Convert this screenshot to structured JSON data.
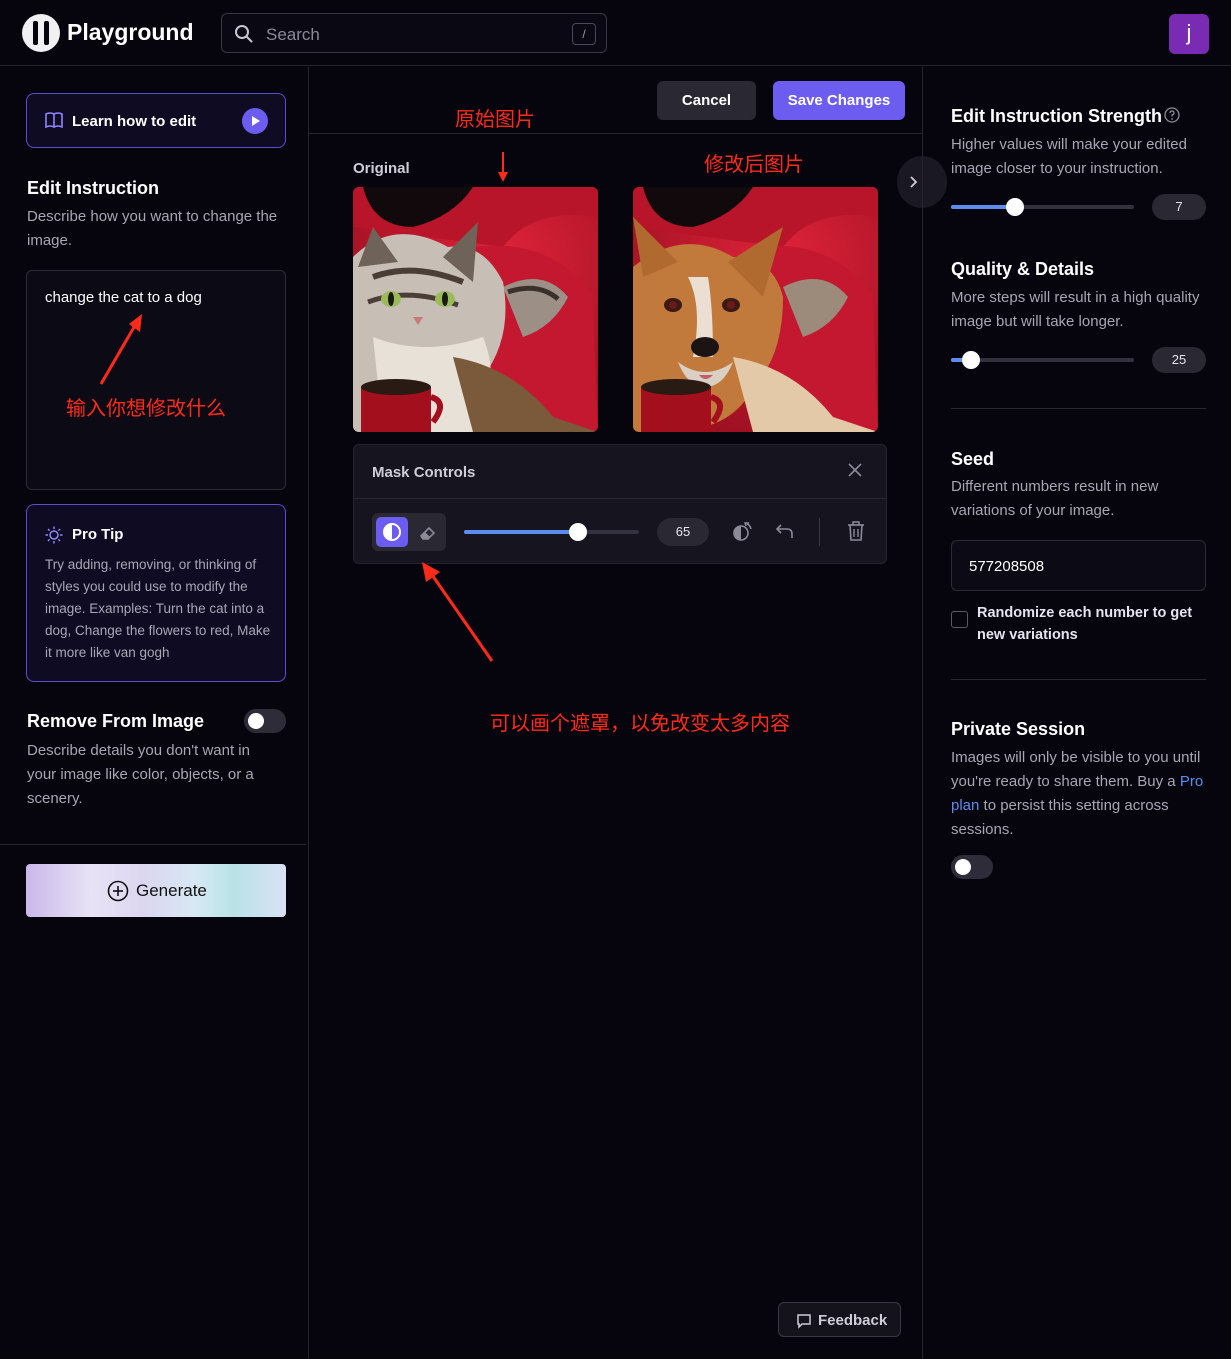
{
  "header": {
    "brand": "Playground",
    "search_placeholder": "Search",
    "search_shortcut": "/",
    "avatar_letter": "j"
  },
  "left": {
    "learn_label": "Learn how to edit",
    "edit_title": "Edit Instruction",
    "edit_desc": "Describe how you want to change the image.",
    "edit_value": "change the cat to a dog",
    "protip_title": "Pro Tip",
    "protip_body": "Try adding, removing, or thinking of styles you could use to modify the image. Examples: Turn the cat into a dog, Change the flowers to red, Make it more like van gogh",
    "remove_title": "Remove From Image",
    "remove_enabled": false,
    "remove_desc": "Describe details you don't want in your image like color, objects, or a scenery.",
    "generate_label": "Generate"
  },
  "center": {
    "cancel_label": "Cancel",
    "save_label": "Save Changes",
    "original_label": "Original",
    "mask_title": "Mask Controls",
    "brush_size": "65",
    "brush_fraction": 0.65,
    "feedback_label": "Feedback"
  },
  "right": {
    "strength_title": "Edit Instruction Strength",
    "strength_desc": "Higher values will make your edited image closer to your instruction.",
    "strength_value": "7",
    "strength_fraction": 0.35,
    "quality_title": "Quality & Details",
    "quality_desc": "More steps will result in a high quality image but will take longer.",
    "quality_value": "25",
    "quality_fraction": 0.11,
    "seed_title": "Seed",
    "seed_desc": "Different numbers result in new variations of your image.",
    "seed_value": "577208508",
    "randomize_label": "Randomize each number to get new variations",
    "private_title": "Private Session",
    "private_desc_1": "Images will only be visible to you until you're ready to share them. Buy a ",
    "private_link": "Pro plan",
    "private_desc_2": " to persist this setting across sessions.",
    "private_enabled": false
  },
  "annotations": {
    "original_image": "原始图片",
    "edited_image": "修改后图片",
    "input_hint": "输入你想修改什么",
    "mask_hint": "可以画个遮罩，以免改变太多内容"
  },
  "colors": {
    "accent": "#6d5cf0",
    "slider_fill": "#5b8def",
    "annotation": "#ff2a1a",
    "background": "#06040d"
  }
}
